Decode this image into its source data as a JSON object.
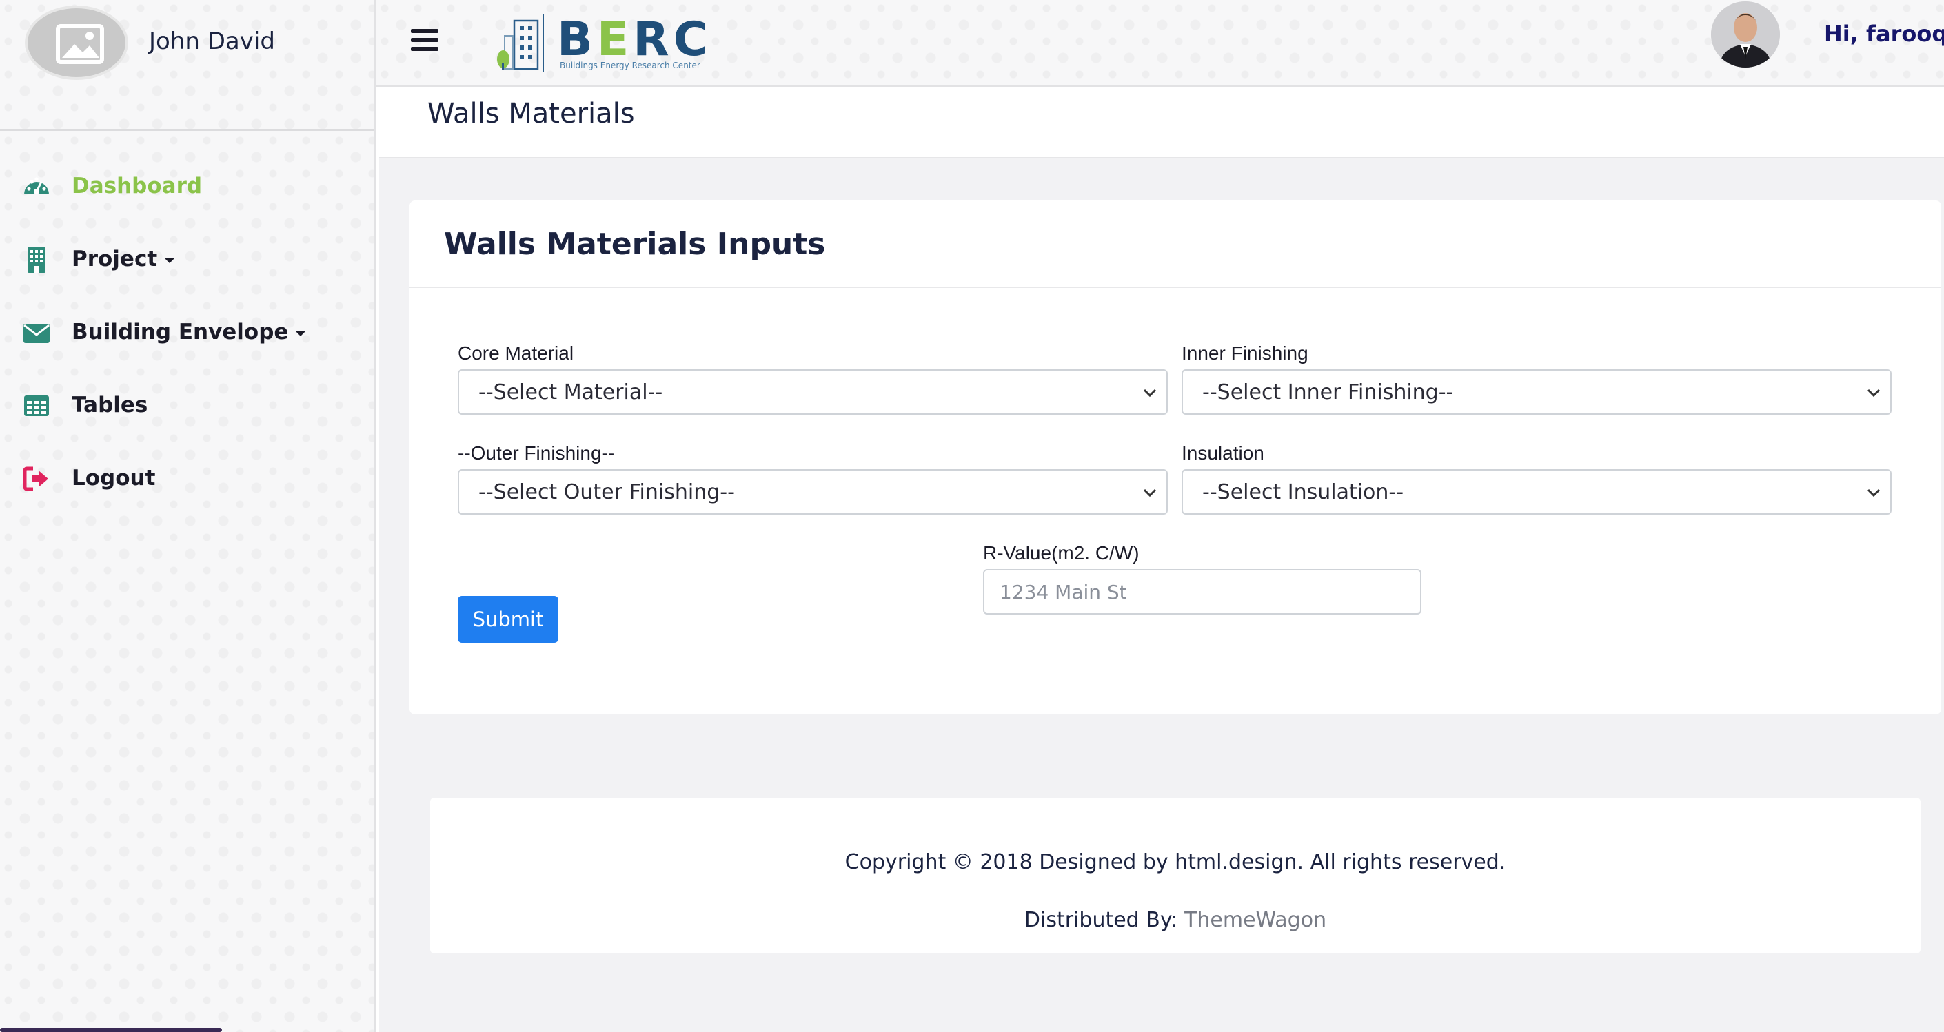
{
  "sidebar": {
    "profile_name": "John David",
    "items": [
      {
        "label": "Dashboard",
        "icon": "speedometer-icon"
      },
      {
        "label": "Project",
        "icon": "building-icon"
      },
      {
        "label": "Building Envelope",
        "icon": "envelope-icon"
      },
      {
        "label": "Tables",
        "icon": "table-icon"
      },
      {
        "label": "Logout",
        "icon": "sign-out-icon"
      }
    ]
  },
  "topbar": {
    "logo_text": "BERC",
    "logo_subtitle": "Buildings Energy Research Center",
    "greeting": "Hi, farooq"
  },
  "page": {
    "title": "Walls Materials"
  },
  "form": {
    "title": "Walls Materials Inputs",
    "core_material": {
      "label": "Core Material",
      "value": "--Select Material--"
    },
    "inner_finishing": {
      "label": "Inner Finishing",
      "value": "--Select Inner Finishing--"
    },
    "outer_finishing": {
      "label": "--Outer Finishing--",
      "value": "--Select Outer Finishing--"
    },
    "insulation": {
      "label": "Insulation",
      "value": "--Select Insulation--"
    },
    "r_value": {
      "label": "R-Value(m2. C/W)",
      "placeholder": "1234 Main St"
    },
    "submit_label": "Submit"
  },
  "footer": {
    "copyright": "Copyright © 2018 Designed by html.design. All rights reserved.",
    "distributed_prefix": "Distributed By: ",
    "distributed_link": "ThemeWagon"
  },
  "colors": {
    "accent_green": "#8bc34a",
    "primary_blue": "#1f7ef0",
    "icon_teal": "#2e8b7a",
    "logout_red": "#e0245e",
    "greeting_navy": "#17176b"
  }
}
